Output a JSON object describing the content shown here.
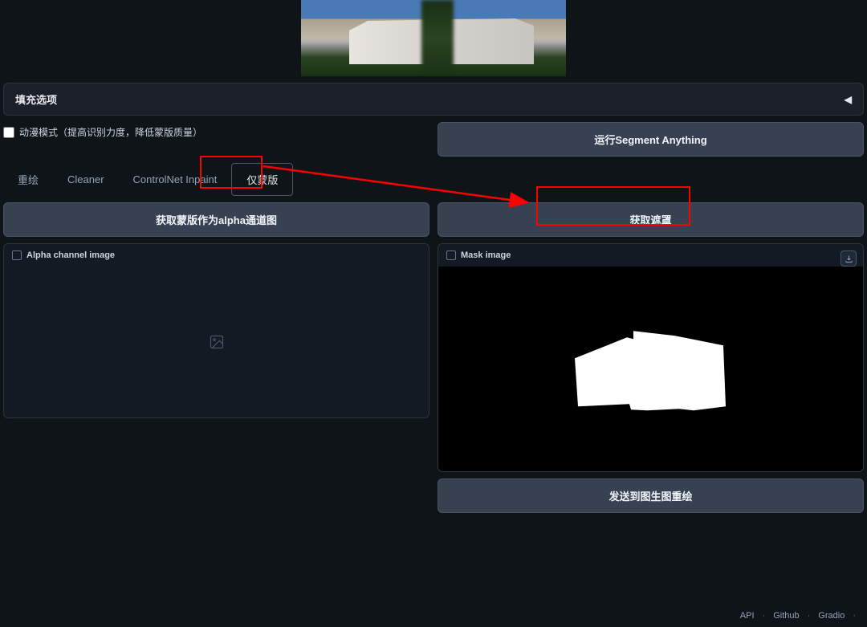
{
  "fill_options_label": "填充选项",
  "anime_mode": {
    "label": "动漫模式（提高识别力度，降低蒙版质量）",
    "checked": false
  },
  "run_segment_button": "运行Segment Anything",
  "tabs": [
    {
      "label": "重绘",
      "active": false
    },
    {
      "label": "Cleaner",
      "active": false
    },
    {
      "label": "ControlNet Inpaint",
      "active": false
    },
    {
      "label": "仅蒙版",
      "active": true
    }
  ],
  "get_alpha_button": "获取蒙版作为alpha通道图",
  "get_mask_button": "获取遮罩",
  "alpha_panel_label": "Alpha channel image",
  "mask_panel_label": "Mask image",
  "send_to_img2img_button": "发送到图生图重绘",
  "footer": {
    "api": "API",
    "github": "Github",
    "gradio": "Gradio"
  }
}
